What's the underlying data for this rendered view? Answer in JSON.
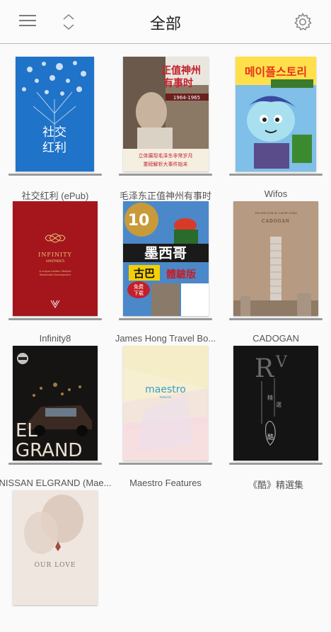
{
  "header": {
    "title": "全部",
    "menu_icon": "hamburger-menu-icon",
    "sort_icon": "sort-updown-icon",
    "settings_icon": "gear-icon"
  },
  "books": [
    {
      "title": "社交红利 (ePub)",
      "cover_text": "社交红利"
    },
    {
      "title": "毛泽东正值神州有事时",
      "cover_text": "正值神州有事时"
    },
    {
      "title": "Wifos",
      "cover_text": "메이플스토리"
    },
    {
      "title": "Infinity8",
      "cover_text": "INFINITY"
    },
    {
      "title": "James Hong Travel Bo...",
      "cover_text": "墨西哥 古巴 體驗版"
    },
    {
      "title": "CADOGAN",
      "cover_text": "CADOGAN"
    },
    {
      "title": "NISSAN ELGRAND (Mae...",
      "cover_text": "EL GRAND"
    },
    {
      "title": "Maestro Features",
      "cover_text": "maestro"
    },
    {
      "title": "《酷》精選集",
      "cover_text": "酷"
    },
    {
      "title": "",
      "cover_text": ""
    }
  ],
  "colors": {
    "header_bg": "#fbfbfb",
    "page_bg": "#fafafa",
    "shelf": "#9a9a9a",
    "label_text": "#555555"
  }
}
